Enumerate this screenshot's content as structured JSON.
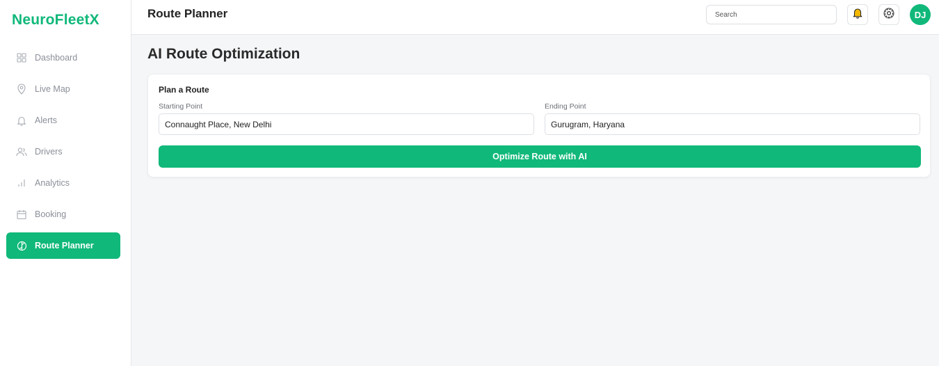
{
  "brand": {
    "name": "NeuroFleetX"
  },
  "sidebar": {
    "items": [
      {
        "label": "Dashboard",
        "icon": "grid-icon",
        "active": false
      },
      {
        "label": "Live Map",
        "icon": "map-pin-icon",
        "active": false
      },
      {
        "label": "Alerts",
        "icon": "bell-icon",
        "active": false
      },
      {
        "label": "Drivers",
        "icon": "users-icon",
        "active": false
      },
      {
        "label": "Analytics",
        "icon": "bar-chart-icon",
        "active": false
      },
      {
        "label": "Booking",
        "icon": "calendar-icon",
        "active": false
      },
      {
        "label": "Route Planner",
        "icon": "compass-icon",
        "active": true
      }
    ]
  },
  "header": {
    "title": "Route Planner",
    "search_placeholder": "Search",
    "notification_icon": "bell-icon",
    "settings_icon": "gear-icon",
    "avatar_initials": "DJ"
  },
  "main": {
    "heading": "AI Route Optimization",
    "card": {
      "title": "Plan a Route",
      "start_label": "Starting Point",
      "start_value": "Connaught Place, New Delhi",
      "end_label": "Ending Point",
      "end_value": "Gurugram, Haryana",
      "button_label": "Optimize Route with AI"
    }
  },
  "colors": {
    "accent": "#10b87a",
    "bell": "#f5b800",
    "background": "#f5f6f8"
  }
}
